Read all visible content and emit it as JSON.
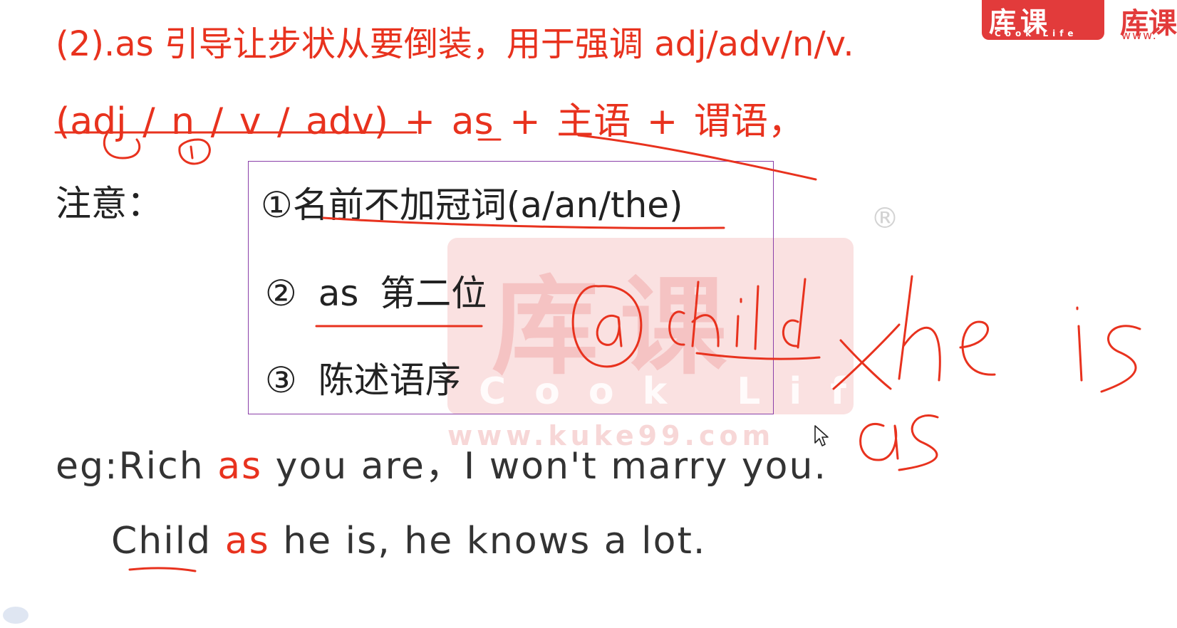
{
  "logo": {
    "chars": "库课",
    "english": "Cook Life",
    "side_chars": "库课",
    "side_url": "www."
  },
  "watermark": {
    "chars": "库课",
    "english": "Cook Life",
    "url": "www.kuke99.com",
    "registered": "®"
  },
  "rule": {
    "heading": "(2).as 引导让步状从要倒装，用于强调 adj/adv/n/v.",
    "formula_part1": "(adj / n / v / adv)",
    "formula_part2": "+ as + 主语 + 谓语，"
  },
  "note": {
    "label": "注意：",
    "items": [
      "①名前不加冠词(a/an/the)",
      "② as 第二位",
      "③ 陈述语序"
    ]
  },
  "examples": {
    "ex1_prefix": "eg:Rich ",
    "ex1_as": "as",
    "ex1_rest": " you are，I won't marry you.",
    "ex2_child": "Child",
    "ex2_space": " ",
    "ex2_as": "as",
    "ex2_rest": " he is, he knows a lot."
  },
  "colors": {
    "highlight_red": "#e8321e",
    "body_text": "#222222",
    "box_border": "#8a3fa8",
    "watermark_red": "#e97878"
  },
  "icons": {
    "cursor": "mouse-pointer-icon"
  }
}
